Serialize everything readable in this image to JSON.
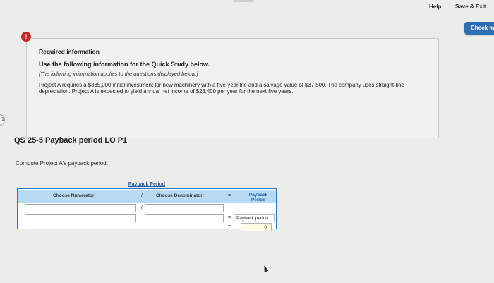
{
  "topbar": {
    "help_label": "Help",
    "save_exit_label": "Save & Exit",
    "check_label": "Check m"
  },
  "side_marker": "1",
  "alert_icon": "!",
  "info": {
    "title": "Required information",
    "subtitle": "Use the following information for the Quick Study below.",
    "note": "[The following information applies to the questions displayed below.]",
    "body": "Project A requires a $385,000 initial investment for new machinery with a five-year life and a salvage value of $37,500. The company uses straight-line depreciation. Project A is expected to yield annual net income of $28,400 per year for the next five years."
  },
  "question": {
    "title": "QS 25-5 Payback period LO P1",
    "prompt": "Compute Project A's payback period."
  },
  "calc": {
    "title": "Payback Period",
    "numerator_label": "Choose Numerator:",
    "denominator_label": "Choose Denominator:",
    "result_label": "Payback Period",
    "divide": "/",
    "equals": "=",
    "row1": {
      "numerator": "",
      "denominator": ""
    },
    "row2": {
      "numerator": "",
      "denominator": "",
      "result_label": "Payback period"
    },
    "row3": {
      "result_value": "0"
    }
  },
  "colors": {
    "accent": "#2c6fb3",
    "alert": "#c62828",
    "table_header": "#b8daf2"
  }
}
